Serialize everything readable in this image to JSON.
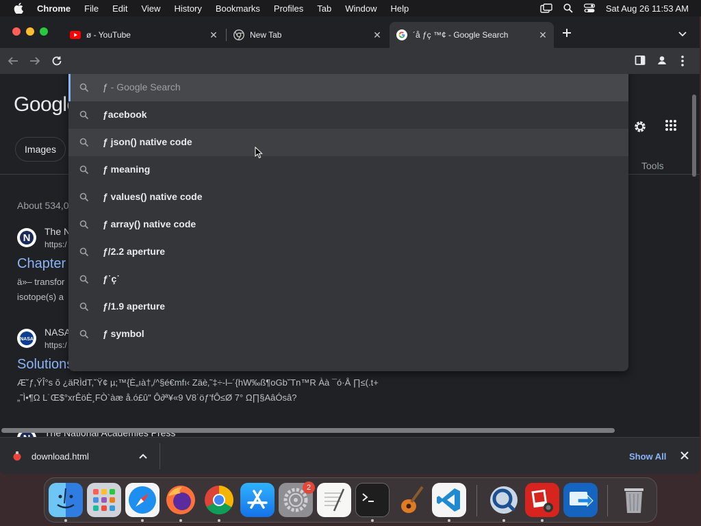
{
  "menubar": {
    "app": "Chrome",
    "items": [
      "File",
      "Edit",
      "View",
      "History",
      "Bookmarks",
      "Profiles",
      "Tab",
      "Window",
      "Help"
    ],
    "clock": "Sat Aug 26  11:53 AM"
  },
  "tabs": [
    {
      "title": "ø - YouTube",
      "icon": "youtube-icon"
    },
    {
      "title": "New Tab",
      "icon": "chrome-icon"
    },
    {
      "title": "´å ƒç ™¢ - Google Search",
      "icon": "google-icon"
    }
  ],
  "omnibox": {
    "query": "ƒ",
    "suggestions": [
      {
        "bold": "ƒ",
        "light": " - Google Search"
      },
      {
        "bold": "ƒacebook",
        "light": ""
      },
      {
        "bold": "ƒ json() native code",
        "light": ""
      },
      {
        "bold": "ƒ meaning",
        "light": ""
      },
      {
        "bold": "ƒ values() native code",
        "light": ""
      },
      {
        "bold": "ƒ array() native code",
        "light": ""
      },
      {
        "bold": "ƒ/2.2 aperture",
        "light": ""
      },
      {
        "bold": "ƒ˙ç˙",
        "light": ""
      },
      {
        "bold": "ƒ/1.9 aperture",
        "light": ""
      },
      {
        "bold": "ƒ symbol",
        "light": ""
      }
    ]
  },
  "page": {
    "logo": "Google",
    "images_chip": "Images",
    "tools": "Tools",
    "result_stats": "About 534,0",
    "results": [
      {
        "site": "The N",
        "url": "https:/",
        "title": "Chapter",
        "snippet1": "ä»– transfor",
        "snippet2": "isotope(s) a"
      },
      {
        "site": "NASA",
        "url": "https:/",
        "title": "Solutions",
        "snippet1": "Æ˘ƒ,ŸÎ°s ŏ ¿äRÌdT,˘Ÿ¢ µ;™{È„ıà†‚/^§é€mfı‹ Zäè‚˜‡÷‑l–´{hW‰ß¶oGb˘Tn™R Àà ¯ó·Å ∏≤(.t+",
        "snippet2": "„˜Ì•¶Ω L˙Œ$°xrÊöÈ¸FÒ`àæ å.ó£û\" Ô∂ª¥«9 V8˙öƒ'fÔ≤Ø 7° Ω∏§AâÓsâ?"
      },
      {
        "site": "The National Academies Press",
        "url": "",
        "title": "",
        "snippet1": "",
        "snippet2": ""
      }
    ]
  },
  "downloads": {
    "file": "download.html",
    "show_all": "Show All"
  },
  "dock": {
    "badge": "2"
  },
  "colors": {
    "accent": "#8ab4f8",
    "background": "#202124",
    "toolbar": "#35363a"
  }
}
